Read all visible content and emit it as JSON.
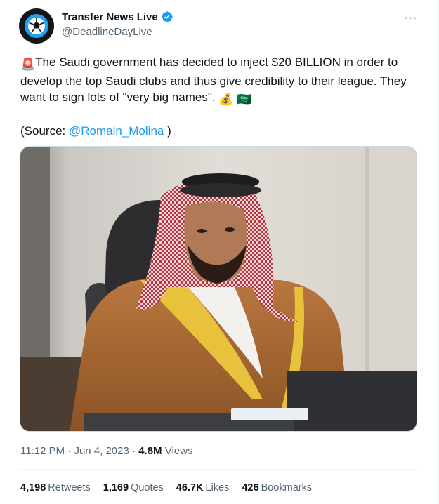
{
  "author": {
    "display_name": "Transfer News Live",
    "handle": "@DeadlineDayLive",
    "verified": true,
    "avatar_icon": "football-icon"
  },
  "tweet": {
    "emoji_alert": "🚨",
    "text": "The Saudi government has decided to inject $20 BILLION in order to develop the top Saudi clubs and thus give credibility to their league. They want to sign lots of \"very big names\".",
    "emoji_money": "💰",
    "emoji_flag": "🇸🇦",
    "source_prefix": "(Source: ",
    "source_link": "@Romain_Molina",
    "source_suffix": " )"
  },
  "meta": {
    "time": "11:12 PM",
    "date": "Jun 4, 2023",
    "views_count": "4.8M",
    "views_label": "Views"
  },
  "stats": {
    "retweets_count": "4,198",
    "retweets_label": "Retweets",
    "quotes_count": "1,169",
    "quotes_label": "Quotes",
    "likes_count": "46.7K",
    "likes_label": "Likes",
    "bookmarks_count": "426",
    "bookmarks_label": "Bookmarks"
  },
  "colors": {
    "link": "#1d9bf0",
    "verified": "#1d9bf0",
    "secondary_text": "#536471"
  }
}
